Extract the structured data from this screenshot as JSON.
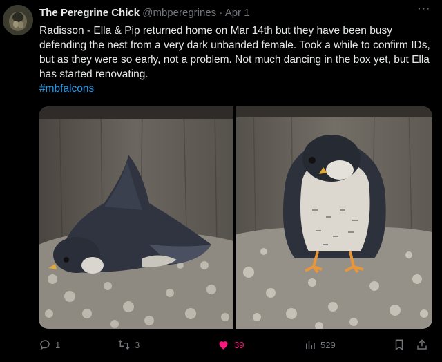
{
  "tweet": {
    "display_name": "The Peregrine Chick",
    "handle": "@mbperegrines",
    "separator": "·",
    "date": "Apr 1",
    "more_label": "···",
    "text": "Radisson - Ella & Pip returned home on Mar 14th but they have been busy defending the nest from a very dark unbanded female. Took a while to confirm IDs, but as they were so early, not a problem. Not much dancing in the box yet, but Ella has started renovating.",
    "hashtag": "#mbfalcons"
  },
  "actions": {
    "replies": "1",
    "retweets": "3",
    "likes": "39",
    "views": "529"
  },
  "colors": {
    "background": "#000000",
    "text": "#e7e9ea",
    "muted": "#71767b",
    "link": "#1d9bf0",
    "like": "#f91880"
  },
  "icons": [
    "avatar",
    "more-icon",
    "reply-icon",
    "retweet-icon",
    "heart-icon",
    "views-icon",
    "bookmark-icon",
    "share-icon"
  ]
}
